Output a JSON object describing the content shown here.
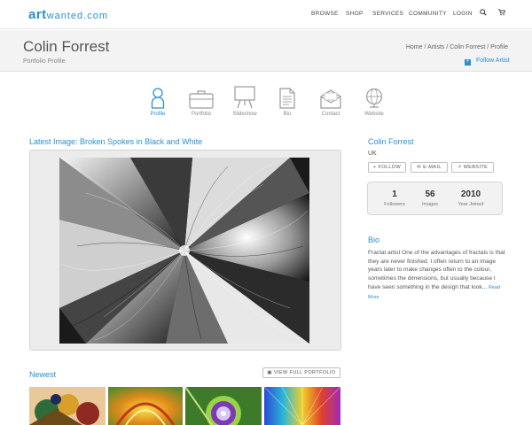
{
  "logo": {
    "art": "art",
    "rest": "wanted.com"
  },
  "nav": {
    "items": [
      "BROWSE",
      "SHOP",
      "SERVICES",
      "COMMUNITY",
      "LOGIN"
    ],
    "icons": [
      "search-icon",
      "cart-icon"
    ]
  },
  "header": {
    "name": "Colin Forrest",
    "subtitle": "Portfolio Profile",
    "breadcrumbs": "Home / Artists / Colin Forrest / Profile",
    "follow_label": "Follow Artist"
  },
  "tabs": [
    {
      "label": "Profile",
      "icon": "person-icon",
      "active": true
    },
    {
      "label": "Portfolio",
      "icon": "briefcase-icon",
      "active": false
    },
    {
      "label": "Slideshow",
      "icon": "easel-icon",
      "active": false
    },
    {
      "label": "Bio",
      "icon": "document-icon",
      "active": false
    },
    {
      "label": "Contact",
      "icon": "envelope-icon",
      "active": false
    },
    {
      "label": "Website",
      "icon": "globe-icon",
      "active": false
    }
  ],
  "latest": {
    "title": "Latest Image: Broken Spokes in Black and White"
  },
  "sidebar": {
    "name": "Colin Forrest",
    "country": "UK",
    "buttons": [
      "FOLLOW",
      "E-MAIL",
      "WEBSITE"
    ],
    "stats": [
      {
        "value": "1",
        "caption": "Followers"
      },
      {
        "value": "56",
        "caption": "Images"
      },
      {
        "value": "2010",
        "caption": "Year Joined"
      }
    ],
    "bio_title": "Bio",
    "bio_text": "Fractal artist One of the advantages of fractals is that they are never finished. I often return to an image years later to make changes often to the colour, sometimes the dimensions, but usually because I have seen something in the design that look...",
    "read_more": "Read More"
  },
  "newest": {
    "title": "Newest",
    "button": "VIEW FULL PORTFOLIO"
  },
  "colors": {
    "accent": "#2a8fcf",
    "band": "#f3f3f3"
  }
}
